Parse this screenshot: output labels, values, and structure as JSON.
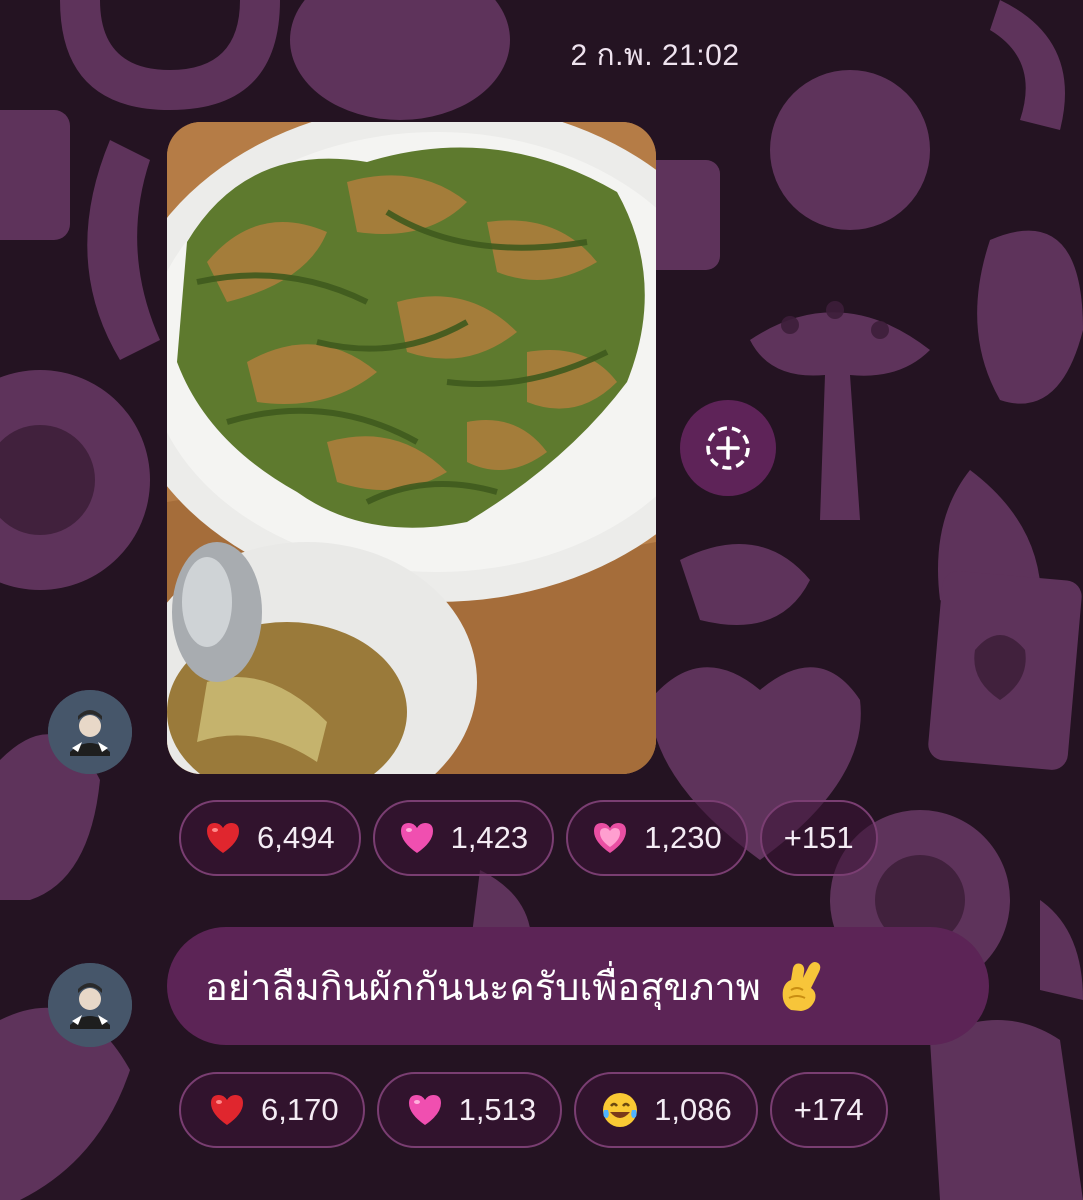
{
  "chat": {
    "timestamp": "2 ก.พ. 21:02",
    "share_icon": "share-circle-plus-icon",
    "messages": [
      {
        "type": "photo",
        "reactions": [
          {
            "emoji": "red-heart",
            "count": "6,494"
          },
          {
            "emoji": "pink-heart",
            "count": "1,423"
          },
          {
            "emoji": "sparkling-heart",
            "count": "1,230"
          }
        ],
        "more": "+151"
      },
      {
        "type": "text",
        "text": "อย่าลืมกินผักกันนะครับเพื่อสุขภาพ",
        "emoji": "crossed-fingers",
        "reactions": [
          {
            "emoji": "red-heart",
            "count": "6,170"
          },
          {
            "emoji": "pink-heart",
            "count": "1,513"
          },
          {
            "emoji": "tears-of-joy",
            "count": "1,086"
          }
        ],
        "more": "+174"
      }
    ]
  },
  "colors": {
    "background": "#241322",
    "bubble": "#5c2456",
    "chip_border": "#7a3e72",
    "text": "#f4ecf4"
  }
}
